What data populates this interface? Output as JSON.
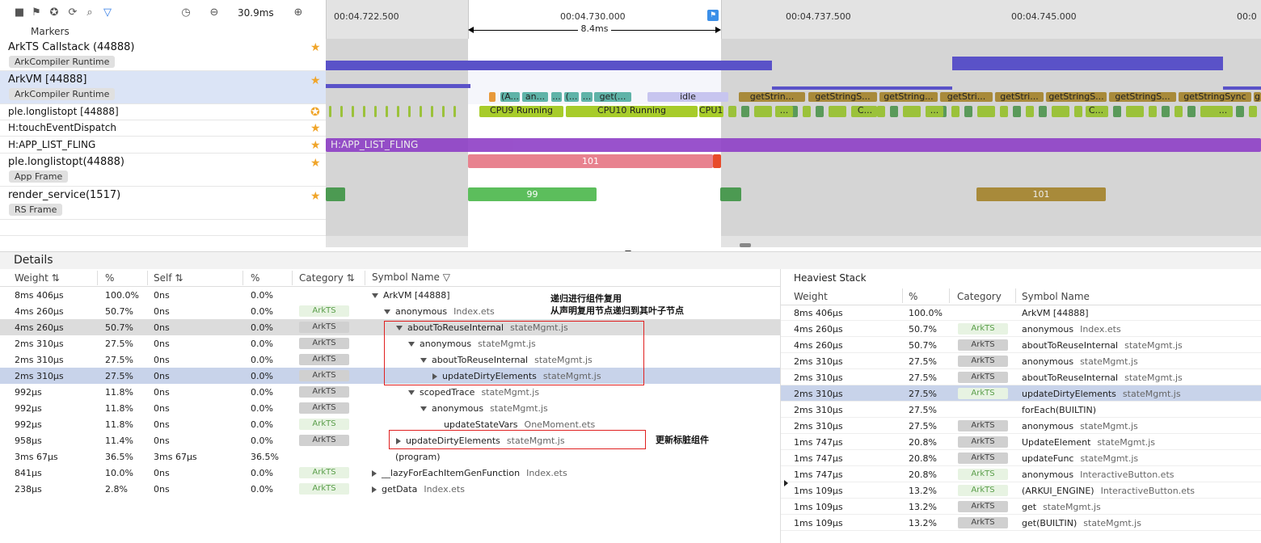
{
  "toolbar": {
    "markers_label": "Markers",
    "zoom": "30.9ms"
  },
  "ruler": {
    "ticks": [
      "00:04.722.500",
      "00:04.730.000",
      "00:04.737.500",
      "00:04.745.000",
      "00:0"
    ],
    "measure": "8.4ms"
  },
  "lanes": [
    {
      "title": "ArkTS Callstack (44888)",
      "sub": "ArkCompiler Runtime"
    },
    {
      "title": "ArkVM [44888]",
      "sub": "ArkCompiler Runtime"
    },
    {
      "title": "ple.longlistopt [44888]"
    },
    {
      "title": "H:touchEventDispatch"
    },
    {
      "title": "H:APP_LIST_FLING"
    },
    {
      "title": "ple.longlistopt(44888)",
      "sub": "App Frame"
    },
    {
      "title": "render_service(1517)",
      "sub": "RS Frame"
    }
  ],
  "slices": {
    "arkvm": [
      "(A...",
      "an...",
      "...",
      "(...",
      "...",
      "get(...",
      "idle",
      "getStrin...",
      "getStringS...",
      "getString...",
      "getStri...",
      "getStri...",
      "getStringS...",
      "getStringS...",
      "getStringSync",
      "g"
    ],
    "cpu": [
      "CPU9 Running",
      "CPU10 Running",
      "CPU10",
      "...",
      "...",
      "C...",
      "...",
      "...",
      "C...",
      "..."
    ],
    "fling": "H:APP_LIST_FLING",
    "app_frame": "101",
    "rs_frames": [
      "99",
      "101"
    ]
  },
  "details": {
    "title": "Details",
    "columns": [
      "Weight",
      "%",
      "Self",
      "%",
      "Category",
      "Symbol Name"
    ],
    "rows": [
      {
        "w": "8ms 406μs",
        "p": "100.0%",
        "s": "0ns",
        "sp": "0.0%",
        "cat": "",
        "sym": "ArkVM [44888]",
        "file": "",
        "indent": 0,
        "exp": "down",
        "style": ""
      },
      {
        "w": "4ms 260μs",
        "p": "50.7%",
        "s": "0ns",
        "sp": "0.0%",
        "cat": "ArkTS",
        "sym": "anonymous",
        "file": "Index.ets",
        "indent": 1,
        "exp": "down",
        "style": ""
      },
      {
        "w": "4ms 260μs",
        "p": "50.7%",
        "s": "0ns",
        "sp": "0.0%",
        "cat": "ArkTS",
        "sym": "aboutToReuseInternal",
        "file": "stateMgmt.js",
        "indent": 2,
        "exp": "down",
        "style": "gray"
      },
      {
        "w": "2ms 310μs",
        "p": "27.5%",
        "s": "0ns",
        "sp": "0.0%",
        "cat": "ArkTS",
        "sym": "anonymous",
        "file": "stateMgmt.js",
        "indent": 3,
        "exp": "down",
        "style": ""
      },
      {
        "w": "2ms 310μs",
        "p": "27.5%",
        "s": "0ns",
        "sp": "0.0%",
        "cat": "ArkTS",
        "sym": "aboutToReuseInternal",
        "file": "stateMgmt.js",
        "indent": 4,
        "exp": "down",
        "style": ""
      },
      {
        "w": "2ms 310μs",
        "p": "27.5%",
        "s": "0ns",
        "sp": "0.0%",
        "cat": "ArkTS",
        "sym": "updateDirtyElements",
        "file": "stateMgmt.js",
        "indent": 5,
        "exp": "right",
        "style": "blue"
      },
      {
        "w": "992μs",
        "p": "11.8%",
        "s": "0ns",
        "sp": "0.0%",
        "cat": "ArkTS",
        "sym": "scopedTrace",
        "file": "stateMgmt.js",
        "indent": 3,
        "exp": "down",
        "style": ""
      },
      {
        "w": "992μs",
        "p": "11.8%",
        "s": "0ns",
        "sp": "0.0%",
        "cat": "ArkTS",
        "sym": "anonymous",
        "file": "stateMgmt.js",
        "indent": 4,
        "exp": "down",
        "style": ""
      },
      {
        "w": "992μs",
        "p": "11.8%",
        "s": "0ns",
        "sp": "0.0%",
        "cat": "ArkTS",
        "sym": "updateStateVars",
        "file": "OneMoment.ets",
        "indent": 5,
        "exp": "",
        "style": ""
      },
      {
        "w": "958μs",
        "p": "11.4%",
        "s": "0ns",
        "sp": "0.0%",
        "cat": "ArkTS",
        "sym": "updateDirtyElements",
        "file": "stateMgmt.js",
        "indent": 2,
        "exp": "right",
        "style": ""
      },
      {
        "w": "3ms 67μs",
        "p": "36.5%",
        "s": "3ms 67μs",
        "sp": "36.5%",
        "cat": "",
        "sym": "(program)",
        "file": "",
        "indent": 1,
        "exp": "",
        "style": ""
      },
      {
        "w": "841μs",
        "p": "10.0%",
        "s": "0ns",
        "sp": "0.0%",
        "cat": "ArkTS",
        "sym": "__lazyForEachItemGenFunction",
        "file": "Index.ets",
        "indent": 0,
        "exp": "right",
        "style": ""
      },
      {
        "w": "238μs",
        "p": "2.8%",
        "s": "0ns",
        "sp": "0.0%",
        "cat": "ArkTS",
        "sym": "getData",
        "file": "Index.ets",
        "indent": 0,
        "exp": "right",
        "style": ""
      }
    ]
  },
  "annotations": {
    "reuse_line1": "递归进行组件复用",
    "reuse_line2": "从声明复用节点递归到其叶子节点",
    "update": "更新标脏组件"
  },
  "heaviest": {
    "title": "Heaviest Stack",
    "columns": [
      "Weight",
      "%",
      "Category",
      "Symbol Name"
    ],
    "rows": [
      {
        "w": "8ms 406μs",
        "p": "100.0%",
        "cat": "",
        "sym": "ArkVM [44888]",
        "file": "",
        "style": ""
      },
      {
        "w": "4ms 260μs",
        "p": "50.7%",
        "cat": "ArkTS",
        "sym": "anonymous",
        "file": "Index.ets",
        "style": ""
      },
      {
        "w": "4ms 260μs",
        "p": "50.7%",
        "cat": "ArkTS",
        "sym": "aboutToReuseInternal",
        "file": "stateMgmt.js",
        "style": ""
      },
      {
        "w": "2ms 310μs",
        "p": "27.5%",
        "cat": "ArkTS",
        "sym": "anonymous",
        "file": "stateMgmt.js",
        "style": ""
      },
      {
        "w": "2ms 310μs",
        "p": "27.5%",
        "cat": "ArkTS",
        "sym": "aboutToReuseInternal",
        "file": "stateMgmt.js",
        "style": ""
      },
      {
        "w": "2ms 310μs",
        "p": "27.5%",
        "cat": "ArkTS",
        "sym": "updateDirtyElements",
        "file": "stateMgmt.js",
        "style": "blue"
      },
      {
        "w": "2ms 310μs",
        "p": "27.5%",
        "cat": "",
        "sym": "forEach(BUILTIN)",
        "file": "",
        "style": ""
      },
      {
        "w": "2ms 310μs",
        "p": "27.5%",
        "cat": "ArkTS",
        "sym": "anonymous",
        "file": "stateMgmt.js",
        "style": ""
      },
      {
        "w": "1ms 747μs",
        "p": "20.8%",
        "cat": "ArkTS",
        "sym": "UpdateElement",
        "file": "stateMgmt.js",
        "style": ""
      },
      {
        "w": "1ms 747μs",
        "p": "20.8%",
        "cat": "ArkTS",
        "sym": "updateFunc",
        "file": "stateMgmt.js",
        "style": ""
      },
      {
        "w": "1ms 747μs",
        "p": "20.8%",
        "cat": "ArkTS",
        "sym": "anonymous",
        "file": "InteractiveButton.ets",
        "style": ""
      },
      {
        "w": "1ms 109μs",
        "p": "13.2%",
        "cat": "ArkTS",
        "sym": "(ARKUI_ENGINE)",
        "file": "InteractiveButton.ets",
        "style": ""
      },
      {
        "w": "1ms 109μs",
        "p": "13.2%",
        "cat": "ArkTS",
        "sym": "get",
        "file": "stateMgmt.js",
        "style": ""
      },
      {
        "w": "1ms 109μs",
        "p": "13.2%",
        "cat": "ArkTS",
        "sym": "get(BUILTIN)",
        "file": "stateMgmt.js",
        "style": ""
      }
    ]
  }
}
